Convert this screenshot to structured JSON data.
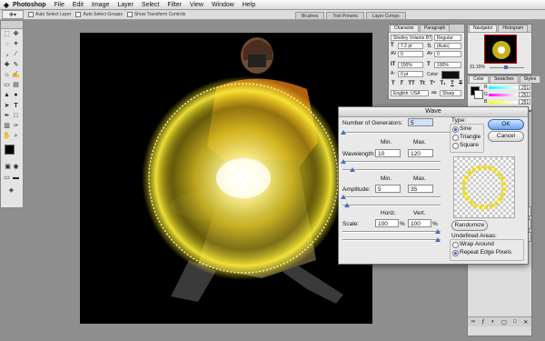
{
  "menubar": {
    "apple": "",
    "app": "Photoshop",
    "items": [
      "File",
      "Edit",
      "Image",
      "Layer",
      "Select",
      "Filter",
      "View",
      "Window",
      "Help"
    ]
  },
  "options_bar": {
    "auto_select_layer": "Auto Select Layer",
    "auto_select_groups": "Auto Select Groups",
    "show_transform_controls": "Show Transform Controls",
    "tabs": [
      "Brushes",
      "Tool Presets",
      "Layer Comps"
    ]
  },
  "character_palette": {
    "tabs": [
      "Character",
      "Paragraph"
    ],
    "font_family": "Shelley Volante BT",
    "font_style": "Regular",
    "font_size": "7.2 pt",
    "leading": "(Auto)",
    "kerning": "0",
    "tracking": "0",
    "vertical_scale": "100%",
    "horizontal_scale": "100%",
    "baseline_shift": "0 pt",
    "color_label": "Color:",
    "language": "English: USA",
    "antialias": "Sharp"
  },
  "navigator_palette": {
    "tabs": [
      "Navigator",
      "Histogram"
    ],
    "zoom": "31.15%"
  },
  "color_palette": {
    "tabs": [
      "Color",
      "Swatches",
      "Styles"
    ],
    "channels": [
      {
        "label": "R",
        "value": "251"
      },
      {
        "label": "G",
        "value": "251"
      },
      {
        "label": "B",
        "value": "251"
      }
    ]
  },
  "wave_dialog": {
    "title": "Wave",
    "generators_label": "Number of Generators:",
    "generators_value": "5",
    "min_label": "Min.",
    "max_label": "Max.",
    "wavelength_label": "Wavelength:",
    "wavelength_min": "10",
    "wavelength_max": "120",
    "amplitude_label": "Amplitude:",
    "amplitude_min": "5",
    "amplitude_max": "35",
    "horiz_label": "Horiz.",
    "vert_label": "Vert.",
    "scale_label": "Scale:",
    "scale_horiz": "100",
    "scale_vert": "100",
    "percent": "%",
    "type_label": "Type:",
    "types": [
      "Sine",
      "Triangle",
      "Square"
    ],
    "selected_type": "Sine",
    "ok": "OK",
    "cancel": "Cancel",
    "randomize": "Randomize",
    "undefined_areas_label": "Undefined Areas:",
    "undefined_options": [
      "Wrap Around",
      "Repeat Edge Pixels"
    ],
    "selected_undefined": "Repeat Edge Pixels"
  },
  "colors": {
    "glow": "#f5e21a",
    "dialog_bg": "#e9e9e9",
    "accent": "#3a6db5"
  }
}
